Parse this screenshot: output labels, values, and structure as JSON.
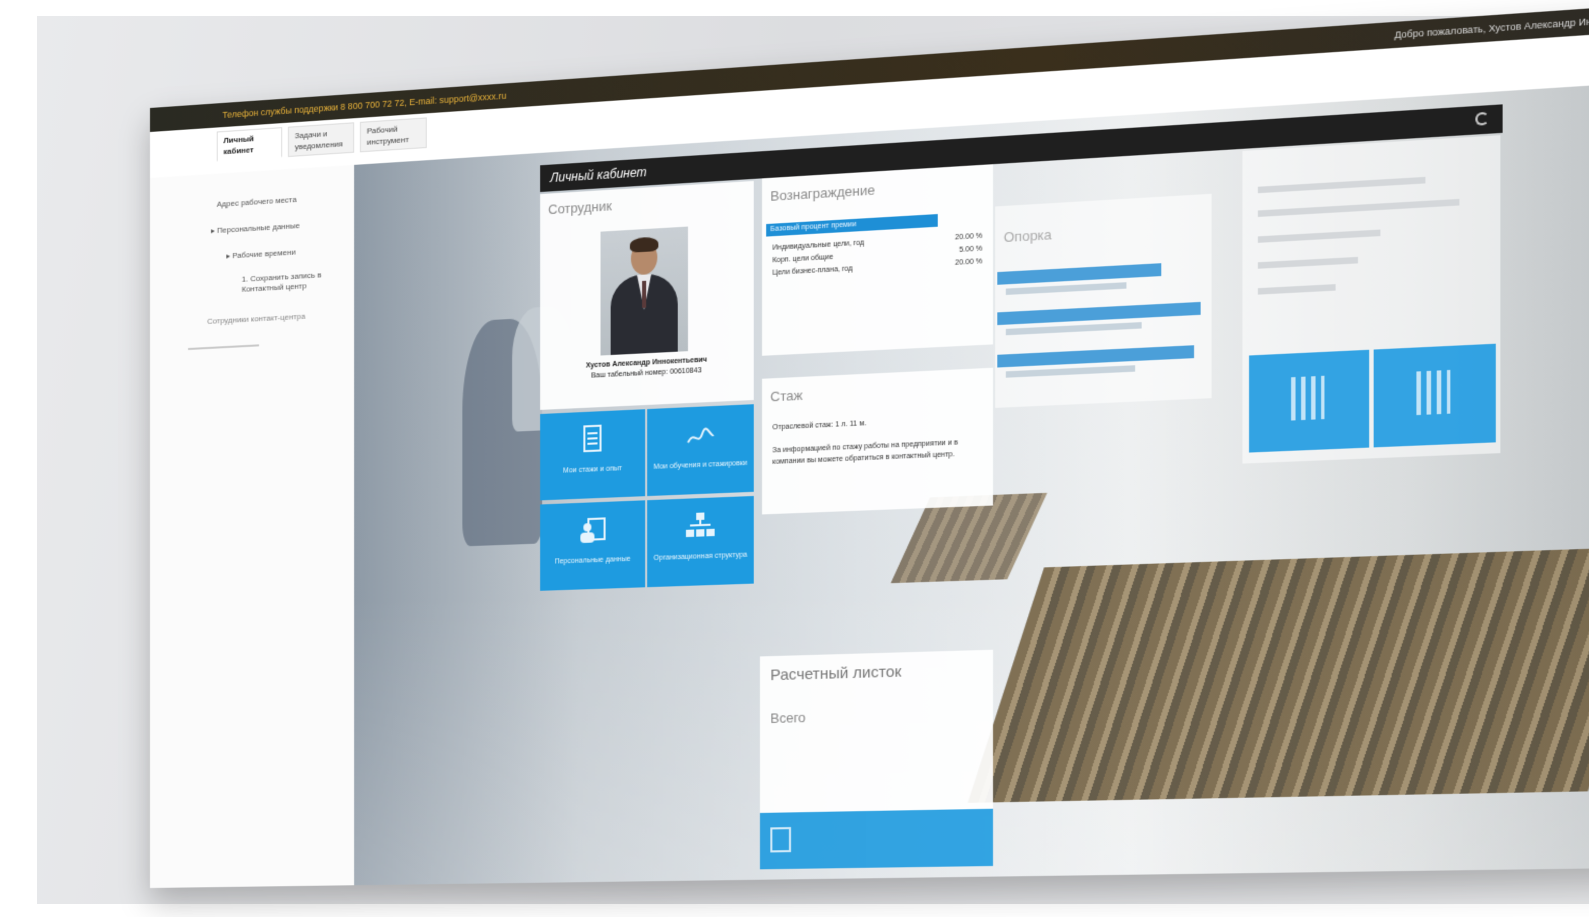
{
  "topbar": {
    "support_text": "Телефон службы поддержки 8 800 700 72 72, E-mail: support@xxxx.ru",
    "right_text": "Добро пожаловать, Хустов Александр Иннокентьевич"
  },
  "tabs": [
    {
      "label": "Личный кабинет"
    },
    {
      "label": "Задачи и уведомления"
    },
    {
      "label": "Рабочий инструмент"
    }
  ],
  "sidebar": {
    "items": [
      "Адрес рабочего места",
      "▸ Персональные данные",
      "▸ Рабочие времени",
      "1. Сохранить запись в Контактный центр",
      "Сотрудники контакт-центра"
    ]
  },
  "panel": {
    "title": "Личный кабинет"
  },
  "employee": {
    "heading": "Сотрудник",
    "name": "Хустов Александр Иннокентьевич",
    "tab_number": "Ваш табельный номер: 00610843"
  },
  "tiles": [
    {
      "label": "Мои стажи и опыт",
      "icon": "document-list-icon"
    },
    {
      "label": "Мои обучения и стажировки",
      "icon": "signature-icon"
    },
    {
      "label": "Персональные данные",
      "icon": "person-card-icon"
    },
    {
      "label": "Организационная структура",
      "icon": "org-chart-icon"
    }
  ],
  "reward": {
    "heading": "Вознаграждение",
    "badge": "Базовый процент премии",
    "rows": [
      {
        "label": "Индивидуальные цели, год",
        "value": "20.00 %"
      },
      {
        "label": "Корп. цели общие",
        "value": "5.00 %"
      },
      {
        "label": "Цели бизнес-плана, год",
        "value": "20.00 %"
      }
    ]
  },
  "experience": {
    "heading": "Стаж",
    "line1": "Отраслевой стаж: 1 л. 11 м.",
    "line2": "За информацией по стажу работы на предприятии и в компании вы можете обратиться в контактный центр."
  },
  "support_card": {
    "heading": "Опорка"
  },
  "payment": {
    "title": "Расчетный листок",
    "sub": "Всего"
  },
  "colors": {
    "accent": "#1e9be0",
    "topbar": "#2a2a22",
    "topbar_text": "#e8b23a"
  }
}
